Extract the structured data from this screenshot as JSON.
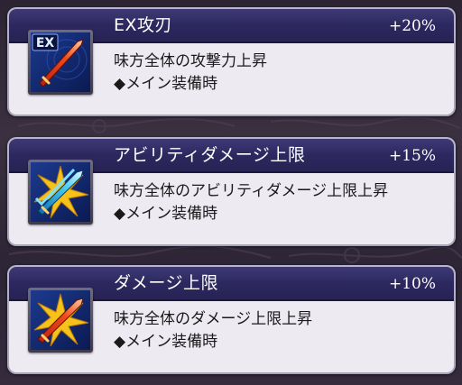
{
  "skills": [
    {
      "title": "EX攻刃",
      "percent": "+20%",
      "description": "味方全体の攻撃力上昇",
      "condition": "◆メイン装備時",
      "icon": "ex-attack-sword-icon",
      "icon_badge": "EX"
    },
    {
      "title": "アビリティダメージ上限",
      "percent": "+15%",
      "description": "味方全体のアビリティダメージ上限上昇",
      "condition": "◆メイン装備時",
      "icon": "ability-damage-cap-icon"
    },
    {
      "title": "ダメージ上限",
      "percent": "+10%",
      "description": "味方全体のダメージ上限上昇",
      "condition": "◆メイン装備時",
      "icon": "damage-cap-icon"
    }
  ],
  "colors": {
    "header": "#2d2960",
    "card_body": "#edeaf2",
    "background": "#2c2433"
  }
}
